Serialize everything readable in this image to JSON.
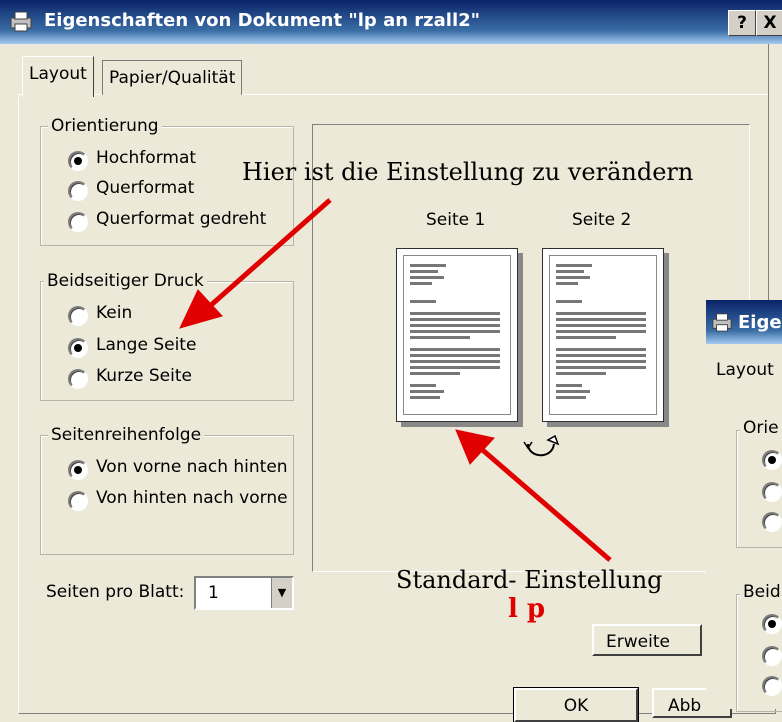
{
  "window": {
    "title": "Eigenschaften von Dokument \"lp an rzall2\"",
    "help_btn": "?",
    "close_btn": "X"
  },
  "tabs": [
    {
      "label": "Layout",
      "active": true
    },
    {
      "label": "Papier/Qualität",
      "active": false
    }
  ],
  "orientation": {
    "legend": "Orientierung",
    "options": [
      "Hochformat",
      "Querformat",
      "Querformat gedreht"
    ],
    "selected": 0
  },
  "duplex": {
    "legend": "Beidseitiger Druck",
    "options": [
      "Kein",
      "Lange Seite",
      "Kurze Seite"
    ],
    "selected": 1
  },
  "page_order": {
    "legend": "Seitenreihenfolge",
    "options": [
      "Von vorne nach hinten",
      "Von hinten nach vorne"
    ],
    "selected": 0
  },
  "pages_per_sheet": {
    "label": "Seiten pro Blatt:",
    "value": "1"
  },
  "preview": {
    "page1": "Seite 1",
    "page2": "Seite 2"
  },
  "buttons": {
    "advanced": "Erweite",
    "ok": "OK",
    "cancel": "Abb"
  },
  "annotations": {
    "top": "Hier ist die Einstellung zu verändern",
    "bottom": "Standard- Einstellung",
    "bottom_red": "l p"
  },
  "second_window": {
    "title": "Eigen",
    "tab": "Layout",
    "legend1": "Orie",
    "legend2": "Beid"
  },
  "colors": {
    "titlebar": "#0a246a",
    "face": "#ece9d8",
    "arrow": "#e00000"
  }
}
